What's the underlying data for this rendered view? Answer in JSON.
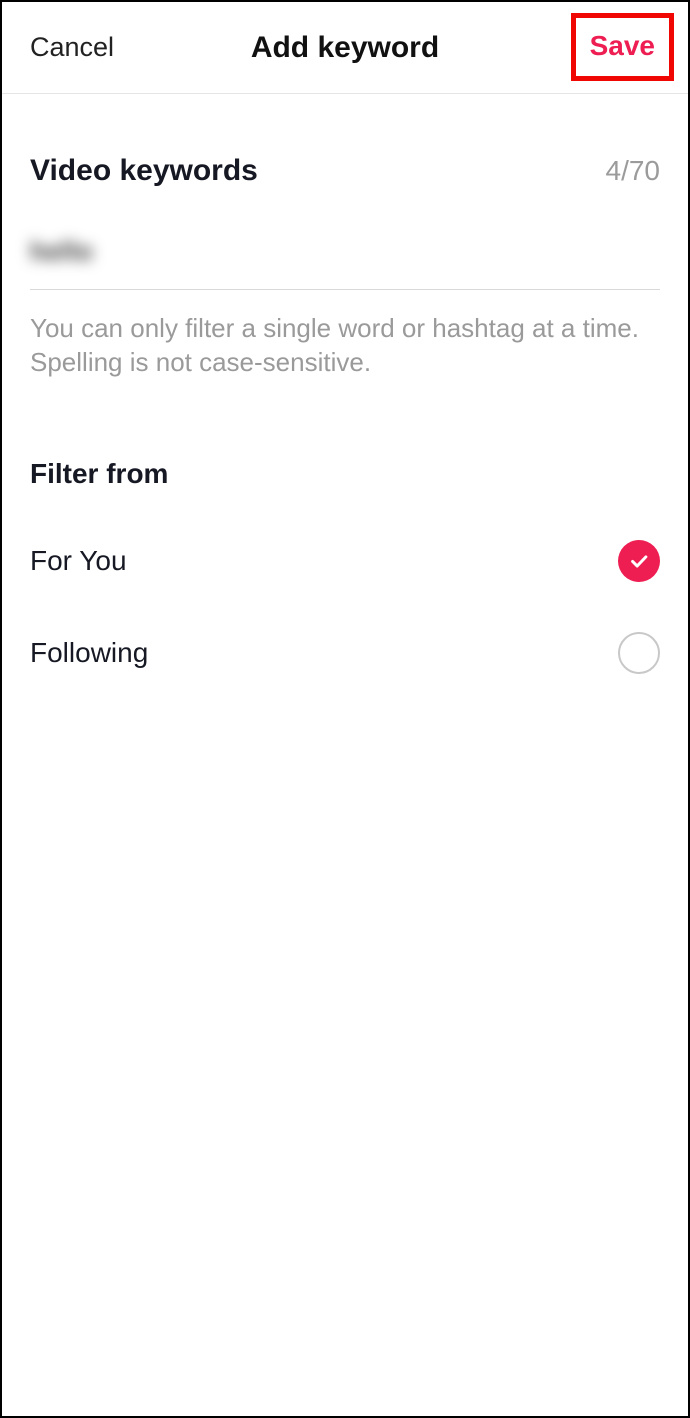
{
  "header": {
    "cancel_label": "Cancel",
    "title": "Add keyword",
    "save_label": "Save"
  },
  "keywords": {
    "section_title": "Video keywords",
    "counter": "4/70",
    "input_value": "hello",
    "helper_text": "You can only filter a single word or hashtag at a time. Spelling is not case-sensitive."
  },
  "filter": {
    "section_title": "Filter from",
    "options": [
      {
        "label": "For You",
        "selected": true
      },
      {
        "label": "Following",
        "selected": false
      }
    ]
  }
}
